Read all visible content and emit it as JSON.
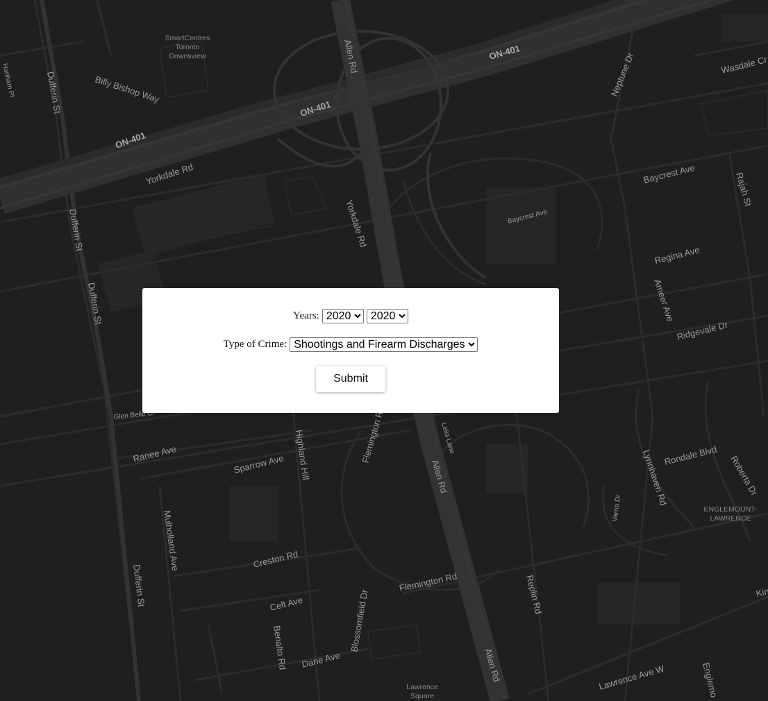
{
  "map": {
    "theme_background": "#1f1f1f",
    "road_color": "#2e2e2e",
    "highway_color": "#333333",
    "label_color": "#9a9a9a",
    "street_labels": {
      "on401_a": "ON-401",
      "on401_b": "ON-401",
      "on401_c": "ON-401",
      "billy_bishop": "Billy Bishop Way",
      "dufferin_1": "Dufferin St",
      "dufferin_2": "Dufferin St",
      "dufferin_3": "Dufferin St",
      "dufferin_4": "Dufferin St",
      "allen_1": "Allen Rd",
      "allen_2": "Allen Rd",
      "allen_3": "Allen Rd",
      "yorkdale_1": "Yorkdale Rd",
      "yorkdale_2": "Yorkdale Rd",
      "baycrest_1": "Baycrest Ave",
      "baycrest_2": "Baycrest Ave",
      "regina": "Regina Ave",
      "ridgevale": "Ridgevale Dr",
      "ameer": "Ameer Ave",
      "neptune": "Neptune Dr",
      "wasdale": "Wasdale Cr",
      "rajah": "Rajah St",
      "ranee": "Ranee Ave",
      "sparrow": "Sparrow Ave",
      "highland": "Highland Hill",
      "flemington_1": "Flemington Rd",
      "flemington_2": "Flemington Rd",
      "leila": "Leila Lane",
      "lynnhaven": "Lynnhaven Rd",
      "rondale": "Rondale Blvd",
      "roberta": "Roberta Dr",
      "varna": "Varna Dr",
      "mulholland": "Mulholland Ave",
      "creston": "Creston Rd",
      "celt": "Celt Ave",
      "benalto": "Benalto Rd",
      "blossomfield": "Blossomfield Dr",
      "dane": "Dane Ave",
      "replin": "Replin Rd",
      "lawrence": "Lawrence Ave W",
      "englemount_rd": "Englemo",
      "glen_belle": "Glen Belle Cr",
      "hanham": "Hanham Pl",
      "kin": "Kin"
    },
    "place_labels": {
      "smartcentres_1": "SmartCentres",
      "smartcentres_2": "Toronto",
      "smartcentres_3": "Downsview",
      "englemount_1": "ENGLEMOUNT-",
      "englemount_2": "LAWRENCE",
      "lawrence_sq_1": "Lawrence",
      "lawrence_sq_2": "Square"
    }
  },
  "form": {
    "years_label": "Years:",
    "year_start_options": [
      "2020"
    ],
    "year_start_value": "2020",
    "year_end_options": [
      "2020"
    ],
    "year_end_value": "2020",
    "crime_label": "Type of Crime:",
    "crime_options": [
      "Shootings and Firearm Discharges"
    ],
    "crime_value": "Shootings and Firearm Discharges",
    "submit_label": "Submit"
  }
}
